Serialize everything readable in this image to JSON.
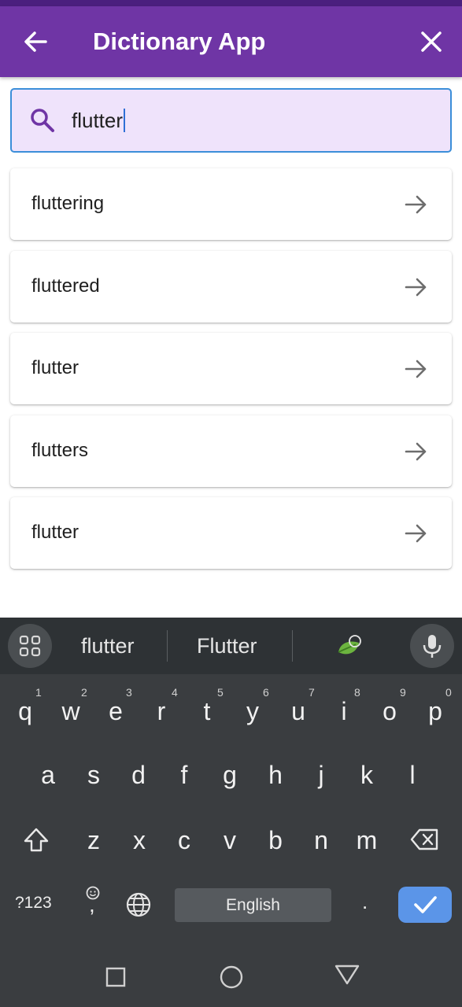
{
  "app_bar": {
    "title": "Dictionary App",
    "back_icon": "arrow-left-icon",
    "close_icon": "close-icon",
    "color": "#6f35a5"
  },
  "search": {
    "icon": "search-icon",
    "value": "flutter",
    "background": "#efe3fb",
    "border_color": "#3b8ed9"
  },
  "results": [
    {
      "word": "fluttering",
      "icon": "arrow-right-icon"
    },
    {
      "word": "fluttered",
      "icon": "arrow-right-icon"
    },
    {
      "word": "flutter",
      "icon": "arrow-right-icon"
    },
    {
      "word": "flutters",
      "icon": "arrow-right-icon"
    },
    {
      "word": "flutter",
      "icon": "arrow-right-icon"
    }
  ],
  "keyboard": {
    "suggestions": [
      "flutter",
      "Flutter"
    ],
    "row1": [
      "q",
      "w",
      "e",
      "r",
      "t",
      "y",
      "u",
      "i",
      "o",
      "p"
    ],
    "row1_hints": [
      "1",
      "2",
      "3",
      "4",
      "5",
      "6",
      "7",
      "8",
      "9",
      "0"
    ],
    "row2": [
      "a",
      "s",
      "d",
      "f",
      "g",
      "h",
      "j",
      "k",
      "l"
    ],
    "row3": [
      "z",
      "x",
      "c",
      "v",
      "b",
      "n",
      "m"
    ],
    "symbols_label": "?123",
    "comma": ",",
    "space_label": "English",
    "period": ".",
    "icons": [
      "apps-grid-icon",
      "sticker-leaf-icon",
      "microphone-icon",
      "shift-icon",
      "backspace-icon",
      "emoji-icon",
      "globe-icon",
      "check-icon"
    ]
  },
  "navigation": {
    "icons": [
      "recents-square-icon",
      "home-circle-icon",
      "back-triangle-icon"
    ]
  }
}
